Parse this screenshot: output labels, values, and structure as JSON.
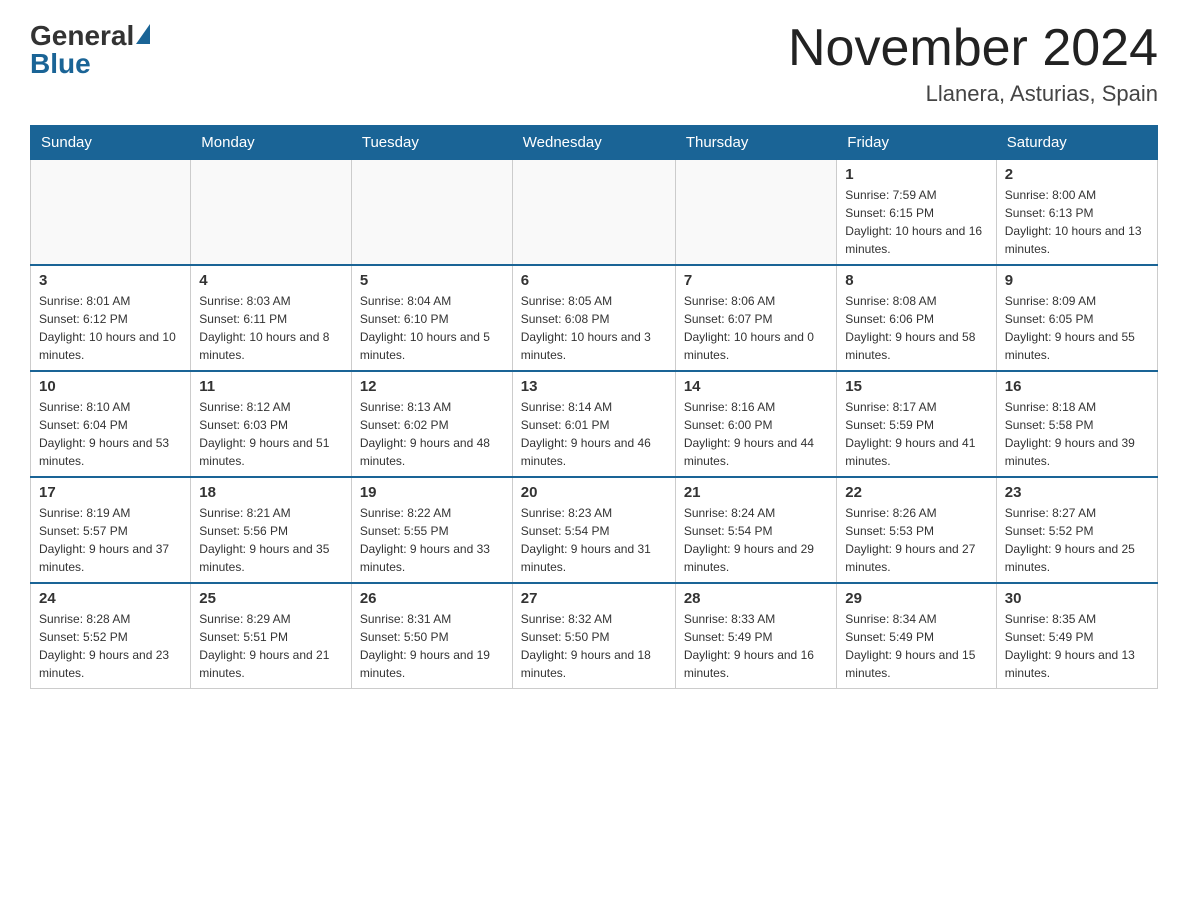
{
  "header": {
    "logo_general": "General",
    "logo_blue": "Blue",
    "month_title": "November 2024",
    "location": "Llanera, Asturias, Spain"
  },
  "weekdays": [
    "Sunday",
    "Monday",
    "Tuesday",
    "Wednesday",
    "Thursday",
    "Friday",
    "Saturday"
  ],
  "rows": [
    {
      "cells": [
        {
          "day": "",
          "sunrise": "",
          "sunset": "",
          "daylight": ""
        },
        {
          "day": "",
          "sunrise": "",
          "sunset": "",
          "daylight": ""
        },
        {
          "day": "",
          "sunrise": "",
          "sunset": "",
          "daylight": ""
        },
        {
          "day": "",
          "sunrise": "",
          "sunset": "",
          "daylight": ""
        },
        {
          "day": "",
          "sunrise": "",
          "sunset": "",
          "daylight": ""
        },
        {
          "day": "1",
          "sunrise": "Sunrise: 7:59 AM",
          "sunset": "Sunset: 6:15 PM",
          "daylight": "Daylight: 10 hours and 16 minutes."
        },
        {
          "day": "2",
          "sunrise": "Sunrise: 8:00 AM",
          "sunset": "Sunset: 6:13 PM",
          "daylight": "Daylight: 10 hours and 13 minutes."
        }
      ]
    },
    {
      "cells": [
        {
          "day": "3",
          "sunrise": "Sunrise: 8:01 AM",
          "sunset": "Sunset: 6:12 PM",
          "daylight": "Daylight: 10 hours and 10 minutes."
        },
        {
          "day": "4",
          "sunrise": "Sunrise: 8:03 AM",
          "sunset": "Sunset: 6:11 PM",
          "daylight": "Daylight: 10 hours and 8 minutes."
        },
        {
          "day": "5",
          "sunrise": "Sunrise: 8:04 AM",
          "sunset": "Sunset: 6:10 PM",
          "daylight": "Daylight: 10 hours and 5 minutes."
        },
        {
          "day": "6",
          "sunrise": "Sunrise: 8:05 AM",
          "sunset": "Sunset: 6:08 PM",
          "daylight": "Daylight: 10 hours and 3 minutes."
        },
        {
          "day": "7",
          "sunrise": "Sunrise: 8:06 AM",
          "sunset": "Sunset: 6:07 PM",
          "daylight": "Daylight: 10 hours and 0 minutes."
        },
        {
          "day": "8",
          "sunrise": "Sunrise: 8:08 AM",
          "sunset": "Sunset: 6:06 PM",
          "daylight": "Daylight: 9 hours and 58 minutes."
        },
        {
          "day": "9",
          "sunrise": "Sunrise: 8:09 AM",
          "sunset": "Sunset: 6:05 PM",
          "daylight": "Daylight: 9 hours and 55 minutes."
        }
      ]
    },
    {
      "cells": [
        {
          "day": "10",
          "sunrise": "Sunrise: 8:10 AM",
          "sunset": "Sunset: 6:04 PM",
          "daylight": "Daylight: 9 hours and 53 minutes."
        },
        {
          "day": "11",
          "sunrise": "Sunrise: 8:12 AM",
          "sunset": "Sunset: 6:03 PM",
          "daylight": "Daylight: 9 hours and 51 minutes."
        },
        {
          "day": "12",
          "sunrise": "Sunrise: 8:13 AM",
          "sunset": "Sunset: 6:02 PM",
          "daylight": "Daylight: 9 hours and 48 minutes."
        },
        {
          "day": "13",
          "sunrise": "Sunrise: 8:14 AM",
          "sunset": "Sunset: 6:01 PM",
          "daylight": "Daylight: 9 hours and 46 minutes."
        },
        {
          "day": "14",
          "sunrise": "Sunrise: 8:16 AM",
          "sunset": "Sunset: 6:00 PM",
          "daylight": "Daylight: 9 hours and 44 minutes."
        },
        {
          "day": "15",
          "sunrise": "Sunrise: 8:17 AM",
          "sunset": "Sunset: 5:59 PM",
          "daylight": "Daylight: 9 hours and 41 minutes."
        },
        {
          "day": "16",
          "sunrise": "Sunrise: 8:18 AM",
          "sunset": "Sunset: 5:58 PM",
          "daylight": "Daylight: 9 hours and 39 minutes."
        }
      ]
    },
    {
      "cells": [
        {
          "day": "17",
          "sunrise": "Sunrise: 8:19 AM",
          "sunset": "Sunset: 5:57 PM",
          "daylight": "Daylight: 9 hours and 37 minutes."
        },
        {
          "day": "18",
          "sunrise": "Sunrise: 8:21 AM",
          "sunset": "Sunset: 5:56 PM",
          "daylight": "Daylight: 9 hours and 35 minutes."
        },
        {
          "day": "19",
          "sunrise": "Sunrise: 8:22 AM",
          "sunset": "Sunset: 5:55 PM",
          "daylight": "Daylight: 9 hours and 33 minutes."
        },
        {
          "day": "20",
          "sunrise": "Sunrise: 8:23 AM",
          "sunset": "Sunset: 5:54 PM",
          "daylight": "Daylight: 9 hours and 31 minutes."
        },
        {
          "day": "21",
          "sunrise": "Sunrise: 8:24 AM",
          "sunset": "Sunset: 5:54 PM",
          "daylight": "Daylight: 9 hours and 29 minutes."
        },
        {
          "day": "22",
          "sunrise": "Sunrise: 8:26 AM",
          "sunset": "Sunset: 5:53 PM",
          "daylight": "Daylight: 9 hours and 27 minutes."
        },
        {
          "day": "23",
          "sunrise": "Sunrise: 8:27 AM",
          "sunset": "Sunset: 5:52 PM",
          "daylight": "Daylight: 9 hours and 25 minutes."
        }
      ]
    },
    {
      "cells": [
        {
          "day": "24",
          "sunrise": "Sunrise: 8:28 AM",
          "sunset": "Sunset: 5:52 PM",
          "daylight": "Daylight: 9 hours and 23 minutes."
        },
        {
          "day": "25",
          "sunrise": "Sunrise: 8:29 AM",
          "sunset": "Sunset: 5:51 PM",
          "daylight": "Daylight: 9 hours and 21 minutes."
        },
        {
          "day": "26",
          "sunrise": "Sunrise: 8:31 AM",
          "sunset": "Sunset: 5:50 PM",
          "daylight": "Daylight: 9 hours and 19 minutes."
        },
        {
          "day": "27",
          "sunrise": "Sunrise: 8:32 AM",
          "sunset": "Sunset: 5:50 PM",
          "daylight": "Daylight: 9 hours and 18 minutes."
        },
        {
          "day": "28",
          "sunrise": "Sunrise: 8:33 AM",
          "sunset": "Sunset: 5:49 PM",
          "daylight": "Daylight: 9 hours and 16 minutes."
        },
        {
          "day": "29",
          "sunrise": "Sunrise: 8:34 AM",
          "sunset": "Sunset: 5:49 PM",
          "daylight": "Daylight: 9 hours and 15 minutes."
        },
        {
          "day": "30",
          "sunrise": "Sunrise: 8:35 AM",
          "sunset": "Sunset: 5:49 PM",
          "daylight": "Daylight: 9 hours and 13 minutes."
        }
      ]
    }
  ]
}
